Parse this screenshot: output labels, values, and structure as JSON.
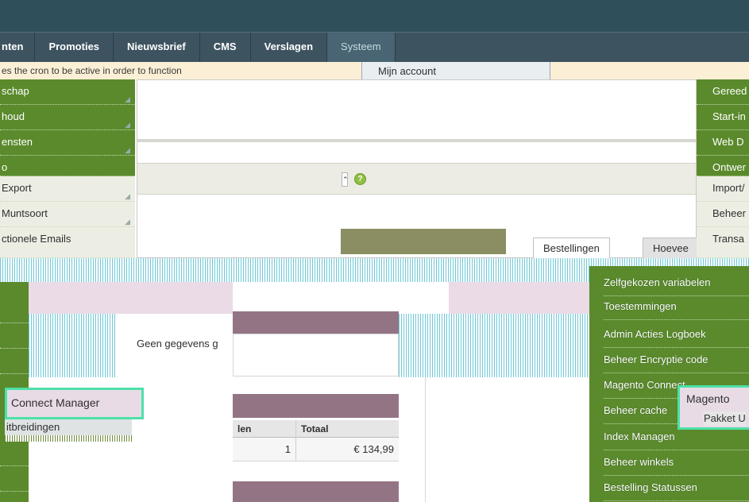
{
  "nav": {
    "items": [
      {
        "label": "nten"
      },
      {
        "label": "Promoties"
      },
      {
        "label": "Nieuwsbrief"
      },
      {
        "label": "CMS"
      },
      {
        "label": "Verslagen"
      },
      {
        "label": "Systeem"
      }
    ]
  },
  "notice": {
    "text": "es the cron to be active in order to function"
  },
  "system_dropdown": {
    "first_item": "Mijn account"
  },
  "left_menu": {
    "items": [
      {
        "label": "schap"
      },
      {
        "label": "houd"
      },
      {
        "label": "ensten"
      },
      {
        "label": "o"
      },
      {
        "label": "Export"
      },
      {
        "label": "Muntsoort"
      },
      {
        "label": "ctionele Emails"
      }
    ]
  },
  "right_menu": {
    "items": [
      {
        "label": "Gereed"
      },
      {
        "label": "Start-in"
      },
      {
        "label": "Web D"
      },
      {
        "label": "Ontwer"
      },
      {
        "label": "Import/"
      },
      {
        "label": "Beheer"
      },
      {
        "label": "Transa"
      }
    ]
  },
  "tabs": {
    "orders": "Bestellingen",
    "quantity": "Hoevee"
  },
  "dashboard": {
    "no_data": "Geen gegevens g"
  },
  "table": {
    "columns": [
      "len",
      "Totaal"
    ],
    "rows": [
      [
        "1",
        "€ 134,99"
      ]
    ]
  },
  "connect_popup": {
    "item": "Connect Manager",
    "sub_item": "itbreidingen"
  },
  "system_menu": {
    "items": [
      {
        "label": "Zelfgekozen variabelen"
      },
      {
        "label": "Toestemmingen"
      },
      {
        "label": "Admin Acties Logboek"
      },
      {
        "label": "Beheer Encryptie code"
      },
      {
        "label": "Magento Connect"
      },
      {
        "label": "Beheer cache"
      },
      {
        "label": "Index Managen"
      },
      {
        "label": "Beheer winkels"
      },
      {
        "label": "Bestelling Statussen"
      }
    ],
    "popup": {
      "item": "Magento",
      "sub_item": "Pakket U"
    }
  }
}
